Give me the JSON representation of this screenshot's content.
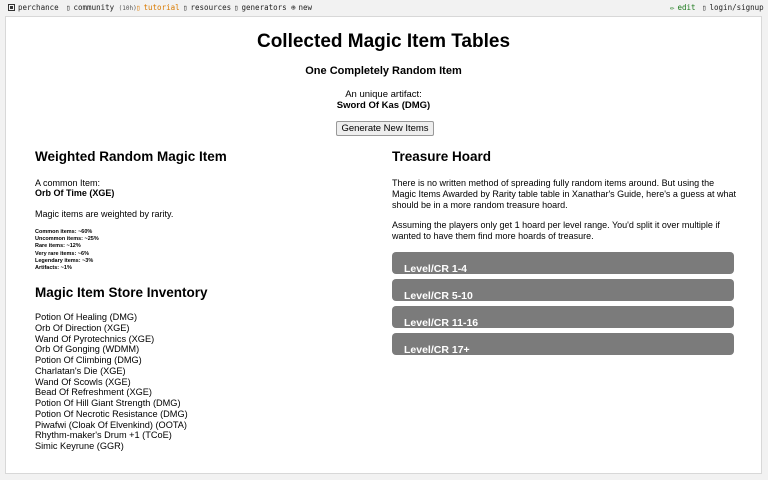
{
  "topbar": {
    "perchance": "perchance",
    "community": "community",
    "community_count": "(10h)",
    "tutorial": "tutorial",
    "resources": "resources",
    "generators": "generators",
    "new": "new",
    "edit": "edit",
    "login": "login/signup"
  },
  "page": {
    "title": "Collected Magic Item Tables",
    "subtitle": "One Completely Random Item",
    "artifact_label": "An unique artifact:",
    "artifact_name": "Sword Of Kas (DMG)",
    "generate_button": "Generate New Items"
  },
  "weighted": {
    "heading": "Weighted Random Magic Item",
    "common_label": "A common Item:",
    "common_item": "Orb Of Time (XGE)",
    "note": "Magic items are weighted by rarity.",
    "odds": [
      "Common items: ~60%",
      "Uncommon items: ~25%",
      "Rare items: ~12%",
      "Very rare items: ~6%",
      "Legendary items: ~3%",
      "Artifacts: ~1%"
    ]
  },
  "store": {
    "heading": "Magic Item Store Inventory",
    "items": [
      "Potion Of Healing (DMG)",
      "Orb Of Direction (XGE)",
      "Wand Of Pyrotechnics (XGE)",
      "Orb Of Gonging (WDMM)",
      "Potion Of Climbing (DMG)",
      "Charlatan's Die (XGE)",
      "Wand Of Scowls (XGE)",
      "Bead Of Refreshment (XGE)",
      "Potion Of Hill Giant Strength (DMG)",
      "Potion Of Necrotic Resistance (DMG)",
      "Piwafwi (Cloak Of Elvenkind) (OOTA)",
      "Rhythm-maker's Drum +1 (TCoE)",
      "Simic Keyrune (GGR)"
    ]
  },
  "hoard": {
    "heading": "Treasure Hoard",
    "para1": "There is no written method of spreading fully random items around. But using the Magic Items Awarded by Rarity table table in Xanathar's Guide, here's a guess at what should be in a more random treasure hoard.",
    "para2": "Assuming the players only get 1 hoard per level range. You'd split it over multiple if wanted to have them find more hoards of treasure.",
    "levels": [
      "Level/CR 1-4",
      "Level/CR 5-10",
      "Level/CR 11-16",
      "Level/CR 17+"
    ]
  },
  "colors": {
    "accent": "#d97a00",
    "edit": "#1c7a1c",
    "bar": "#7b7b7b"
  }
}
